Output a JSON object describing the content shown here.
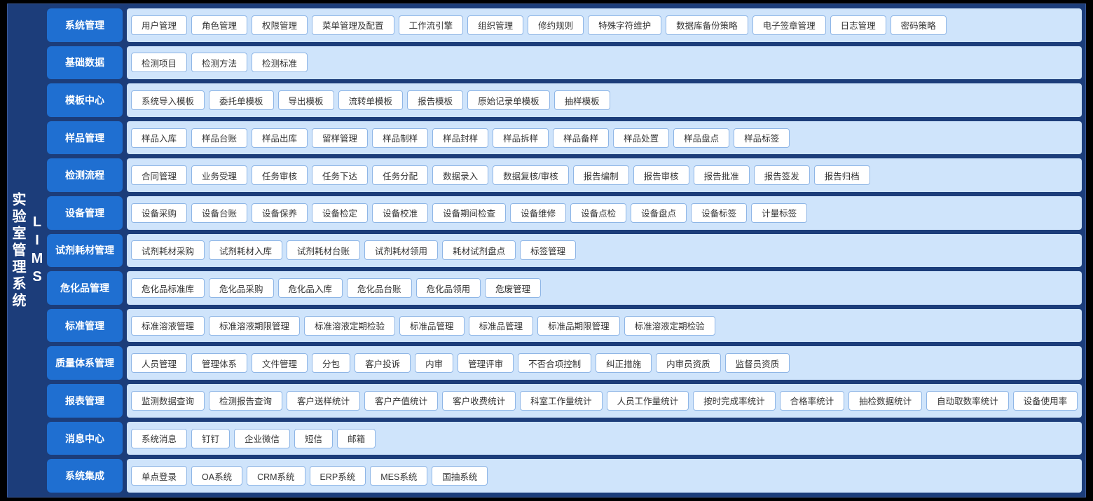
{
  "sidebar_title_line1": "LIMS",
  "sidebar_title_line2": "实验室管理系统",
  "rows": [
    {
      "category": "系统管理",
      "items": [
        "用户管理",
        "角色管理",
        "权限管理",
        "菜单管理及配置",
        "工作流引擎",
        "组织管理",
        "修约规则",
        "特殊字符维护",
        "数据库备份策略",
        "电子签章管理",
        "日志管理",
        "密码策略"
      ]
    },
    {
      "category": "基础数据",
      "items": [
        "检测项目",
        "检测方法",
        "检测标准"
      ]
    },
    {
      "category": "模板中心",
      "items": [
        "系统导入模板",
        "委托单模板",
        "导出模板",
        "流转单模板",
        "报告模板",
        "原始记录单模板",
        "抽样模板"
      ]
    },
    {
      "category": "样品管理",
      "items": [
        "样品入库",
        "样品台账",
        "样品出库",
        "留样管理",
        "样品制样",
        "样品封样",
        "样品拆样",
        "样品备样",
        "样品处置",
        "样品盘点",
        "样品标签"
      ]
    },
    {
      "category": "检测流程",
      "items": [
        "合同管理",
        "业务受理",
        "任务审核",
        "任务下达",
        "任务分配",
        "数据录入",
        "数据复核/审核",
        "报告编制",
        "报告审核",
        "报告批准",
        "报告签发",
        "报告归档"
      ]
    },
    {
      "category": "设备管理",
      "items": [
        "设备采购",
        "设备台账",
        "设备保养",
        "设备检定",
        "设备校准",
        "设备期间检查",
        "设备维修",
        "设备点检",
        "设备盘点",
        "设备标签",
        "计量标签"
      ]
    },
    {
      "category": "试剂耗材管理",
      "items": [
        "试剂耗材采购",
        "试剂耗材入库",
        "试剂耗材台账",
        "试剂耗材领用",
        "耗材试剂盘点",
        "标签管理"
      ]
    },
    {
      "category": "危化品管理",
      "items": [
        "危化品标准库",
        "危化品采购",
        "危化品入库",
        "危化品台账",
        "危化品领用",
        "危废管理"
      ]
    },
    {
      "category": "标准管理",
      "items": [
        "标准溶液管理",
        "标准溶液期限管理",
        "标准溶液定期检验",
        "标准品管理",
        "标准品管理",
        "标准品期限管理",
        "标准溶液定期检验"
      ]
    },
    {
      "category": "质量体系管理",
      "items": [
        "人员管理",
        "管理体系",
        "文件管理",
        "分包",
        "客户投诉",
        "内审",
        "管理评审",
        "不否合项控制",
        "纠正措施",
        "内审员资质",
        "监督员资质"
      ]
    },
    {
      "category": "报表管理",
      "items": [
        "监测数据查询",
        "检测报告查询",
        "客户送样统计",
        "客户产值统计",
        "客户收费统计",
        "科室工作量统计",
        "人员工作量统计",
        "按时完成率统计",
        "合格率统计",
        "抽检数据统计",
        "自动取数率统计",
        "设备使用率"
      ]
    },
    {
      "category": "消息中心",
      "items": [
        "系统消息",
        "钉钉",
        "企业微信",
        "短信",
        "邮箱"
      ]
    },
    {
      "category": "系统集成",
      "items": [
        "单点登录",
        "OA系统",
        "CRM系统",
        "ERP系统",
        "MES系统",
        "国抽系统"
      ]
    }
  ]
}
